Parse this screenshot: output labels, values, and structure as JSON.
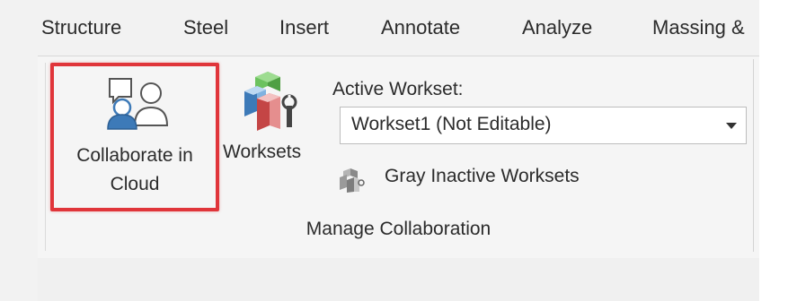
{
  "tabs": [
    {
      "label": "Structure"
    },
    {
      "label": "Steel"
    },
    {
      "label": "Insert"
    },
    {
      "label": "Annotate"
    },
    {
      "label": "Analyze"
    },
    {
      "label": "Massing &"
    }
  ],
  "ribbon": {
    "collaborate_button": {
      "line1": "Collaborate in",
      "line2": "Cloud",
      "icon": "collaborate-cloud-icon"
    },
    "worksets_button": {
      "label": "Worksets",
      "icon": "worksets-icon"
    },
    "active_workset": {
      "label": "Active Workset:",
      "selected": "Workset1 (Not Editable)"
    },
    "gray_inactive": {
      "label": "Gray Inactive Worksets",
      "icon": "gray-worksets-icon"
    },
    "panel_title": "Manage Collaboration"
  },
  "colors": {
    "highlight": "#e0353a",
    "icon_blue": "#3d7ab8",
    "icon_green": "#4f9f43",
    "icon_red": "#c44545"
  }
}
